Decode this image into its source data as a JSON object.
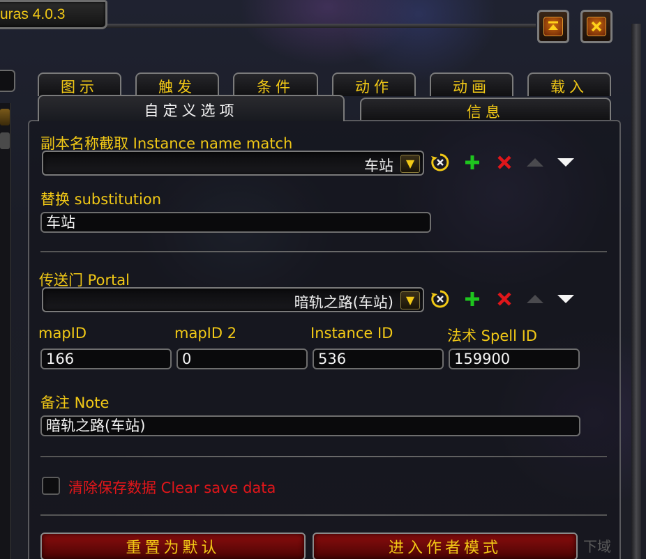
{
  "window": {
    "title": "uras 4.0.3",
    "collapse_icon": "collapse-icon",
    "close_icon": "close-icon"
  },
  "tabs": [
    {
      "label": "图示"
    },
    {
      "label": "触发"
    },
    {
      "label": "条件"
    },
    {
      "label": "动作"
    },
    {
      "label": "动画"
    },
    {
      "label": "载入"
    }
  ],
  "subtabs": [
    {
      "label": "自定义选项",
      "active": true
    },
    {
      "label": "信息",
      "active": false
    }
  ],
  "instance": {
    "label": "副本名称截取 Instance name match",
    "selected": "车站",
    "substitution_label": "替换 substitution",
    "substitution_value": "车站"
  },
  "portal": {
    "label": "传送门 Portal",
    "selected": "暗轨之路(车站)",
    "fields": [
      {
        "label": "mapID",
        "value": "166"
      },
      {
        "label": "mapID 2",
        "value": "0"
      },
      {
        "label": "Instance ID",
        "value": "536"
      },
      {
        "label": "法术 Spell ID",
        "value": "159900"
      }
    ],
    "note_label": "备注 Note",
    "note_value": "暗轨之路(车站)"
  },
  "clear_save": {
    "label": "清除保存数据 Clear save data",
    "checked": false
  },
  "buttons": {
    "reset": "重置为默认",
    "author_mode": "进入作者模式",
    "ghost": "下域"
  },
  "colors": {
    "gold": "#f2c916",
    "red": "#e0161a",
    "green_plus": "#1ec51e",
    "button_red": "#8a0d0d"
  }
}
